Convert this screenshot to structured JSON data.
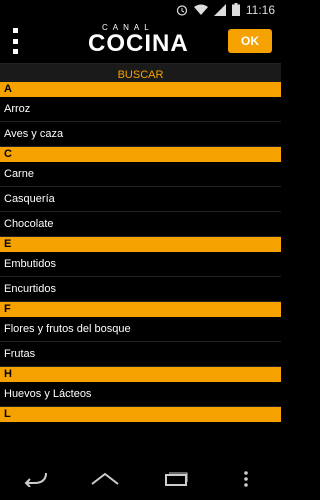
{
  "status": {
    "time": "11:16"
  },
  "app": {
    "logo_small": "CANAL",
    "logo_big": "COCINA",
    "ok_label": "OK",
    "search_label": "BUSCAR"
  },
  "sections": [
    {
      "letter": "A",
      "items": [
        "Arroz",
        "Aves y caza"
      ]
    },
    {
      "letter": "C",
      "items": [
        "Carne",
        "Casquería",
        "Chocolate"
      ]
    },
    {
      "letter": "E",
      "items": [
        "Embutidos",
        "Encurtidos"
      ]
    },
    {
      "letter": "F",
      "items": [
        "Flores y frutos del bosque",
        "Frutas"
      ]
    },
    {
      "letter": "H",
      "items": [
        "Huevos y Lácteos"
      ]
    },
    {
      "letter": "L",
      "items": []
    }
  ],
  "colors": {
    "accent": "#f5a100",
    "background": "#000000"
  },
  "icons": [
    "alarm-icon",
    "wifi-icon",
    "signal-icon",
    "battery-icon",
    "back-icon",
    "home-icon",
    "recents-icon",
    "overflow-icon"
  ]
}
